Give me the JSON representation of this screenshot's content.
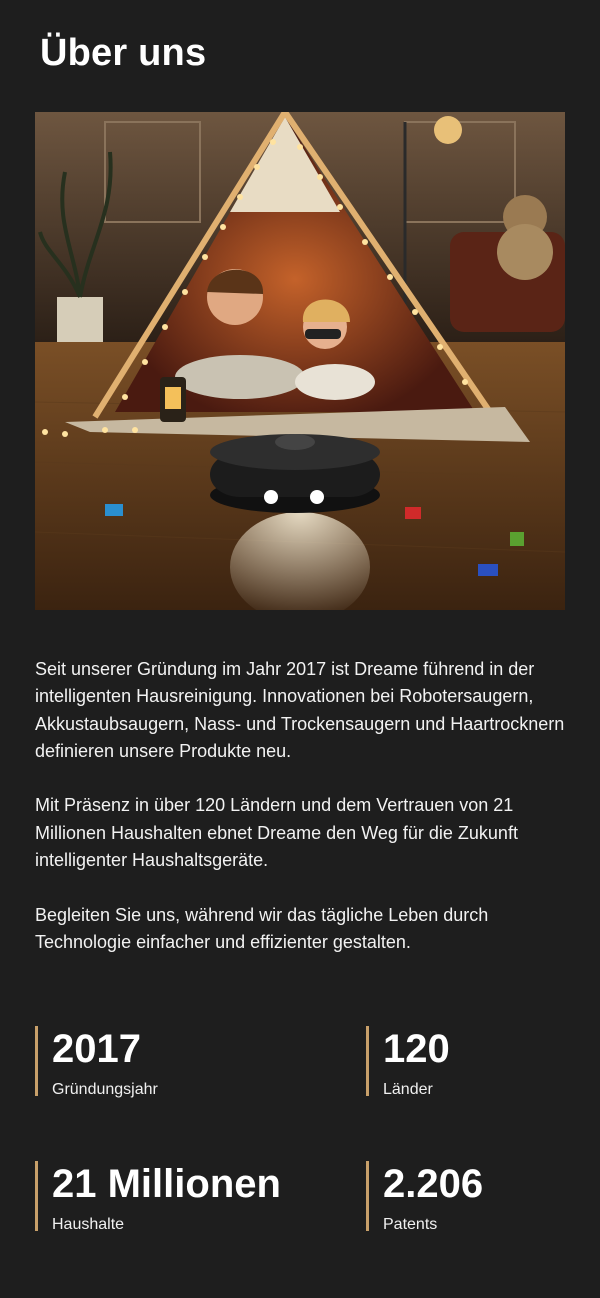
{
  "page": {
    "title": "Über uns"
  },
  "hero_image": {
    "alt": "Zwei Kinder liegen vor einem beleuchteten Tipi-Zelt, davor ein Saugroboter mit leuchtenden Frontlichtern"
  },
  "paragraphs": [
    "Seit unserer Gründung im Jahr 2017 ist Dreame führend in der intelligenten Hausreinigung. Innovationen bei Robotersaugern, Akkustaubsaugern, Nass- und Trockensaugern und Haartrocknern definieren unsere Produkte neu.",
    "Mit Präsenz in über 120 Ländern und dem Vertrauen von 21 Millionen Haushalten ebnet Dreame den Weg für die Zukunft intelligenter Haushaltsgeräte.",
    "Begleiten Sie uns, während wir das tägliche Leben durch Technologie einfacher und effizienter gestalten."
  ],
  "stats": [
    {
      "value": "2017",
      "label": "Gründungsjahr"
    },
    {
      "value": "120",
      "label": "Länder"
    },
    {
      "value": "21 Millionen",
      "label": "Haushalte"
    },
    {
      "value": "2.206",
      "label": "Patents"
    }
  ],
  "colors": {
    "background": "#1e1e1e",
    "accent": "#c8a06a",
    "text": "#ffffff"
  }
}
